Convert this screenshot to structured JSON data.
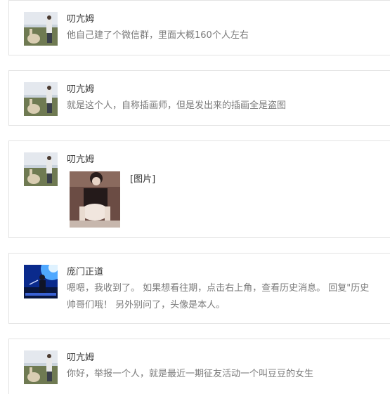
{
  "messages": [
    {
      "name": "叨亢姆",
      "text": "他自己建了个微信群，里面大概160个人左右",
      "avatar": "alpaca-photo"
    },
    {
      "name": "叨亢姆",
      "text": "就是这个人，自称插画师，但是发出来的插画全是盗图",
      "avatar": "alpaca-photo"
    },
    {
      "name": "叨亢姆",
      "image_label": "[图片]",
      "avatar": "alpaca-photo",
      "attachment": "girl-photo"
    },
    {
      "name": "庞门正道",
      "text_line1": "嗯嗯，我收到了。 如果想看往期，点击右上角，查看历史消息。 回复\"历史",
      "text_line2": "帅哥们哦！ 另外别问了，头像是本人。",
      "avatar": "singer-photo"
    },
    {
      "name": "叨亢姆",
      "text": "你好，举报一个人，就是最近一期征友活动一个叫豆豆的女生",
      "avatar": "alpaca-photo"
    }
  ]
}
